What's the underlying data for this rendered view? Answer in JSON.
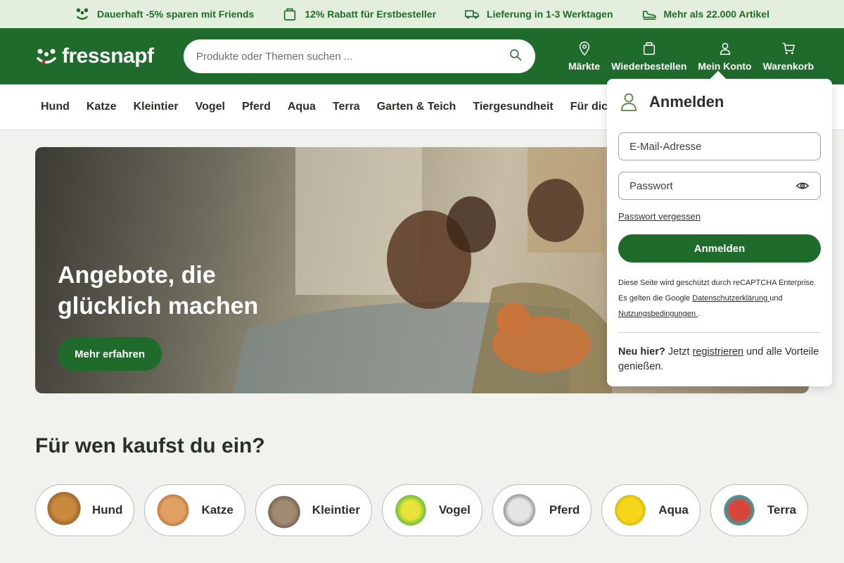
{
  "usp": [
    {
      "icon": "friends-icon",
      "text": "Dauerhaft -5% sparen mit Friends"
    },
    {
      "icon": "bag-icon",
      "text": "12% Rabatt für Erstbesteller"
    },
    {
      "icon": "truck-icon",
      "text": "Lieferung in 1-3 Werktagen"
    },
    {
      "icon": "shoe-icon",
      "text": "Mehr als 22.000 Artikel"
    }
  ],
  "header": {
    "logo_text": "fressnapf",
    "search_placeholder": "Produkte oder Themen suchen ...",
    "actions": [
      {
        "icon": "location-pin-icon",
        "label": "Märkte"
      },
      {
        "icon": "reorder-bag-icon",
        "label": "Wiederbestellen"
      },
      {
        "icon": "user-icon",
        "label": "Mein Konto"
      },
      {
        "icon": "cart-icon",
        "label": "Warenkorb"
      }
    ]
  },
  "nav": [
    "Hund",
    "Katze",
    "Kleintier",
    "Vogel",
    "Pferd",
    "Aqua",
    "Terra",
    "Garten & Teich",
    "Tiergesundheit",
    "Für dich"
  ],
  "hero": {
    "title": "Angebote, die glücklich machen",
    "cta": "Mehr erfahren"
  },
  "section_title": "Für wen kaufst du ein?",
  "pets": [
    "Hund",
    "Katze",
    "Kleintier",
    "Vogel",
    "Pferd",
    "Aqua",
    "Terra"
  ],
  "login": {
    "title": "Anmelden",
    "email_placeholder": "E-Mail-Adresse",
    "password_placeholder": "Passwort",
    "forgot": "Passwort vergessen",
    "submit": "Anmelden",
    "recaptcha_line1": "Diese Seite wird geschützt durch reCAPTCHA Enterprise.",
    "recaptcha_line2a": "Es gelten die Google ",
    "privacy_link": "Datenschutzerklärung ",
    "recaptcha_and": "und",
    "terms_link": "Nutzungsbedingungen ",
    "recaptcha_end": ".",
    "new_bold": "Neu hier?",
    "new_text1": " Jetzt ",
    "register_link": "registrieren",
    "new_text2": " und alle Vorteile genießen."
  },
  "colors": {
    "brand_green": "#1e6b2b",
    "usp_bg": "#e3eedc",
    "page_bg": "#f1f2ee"
  }
}
